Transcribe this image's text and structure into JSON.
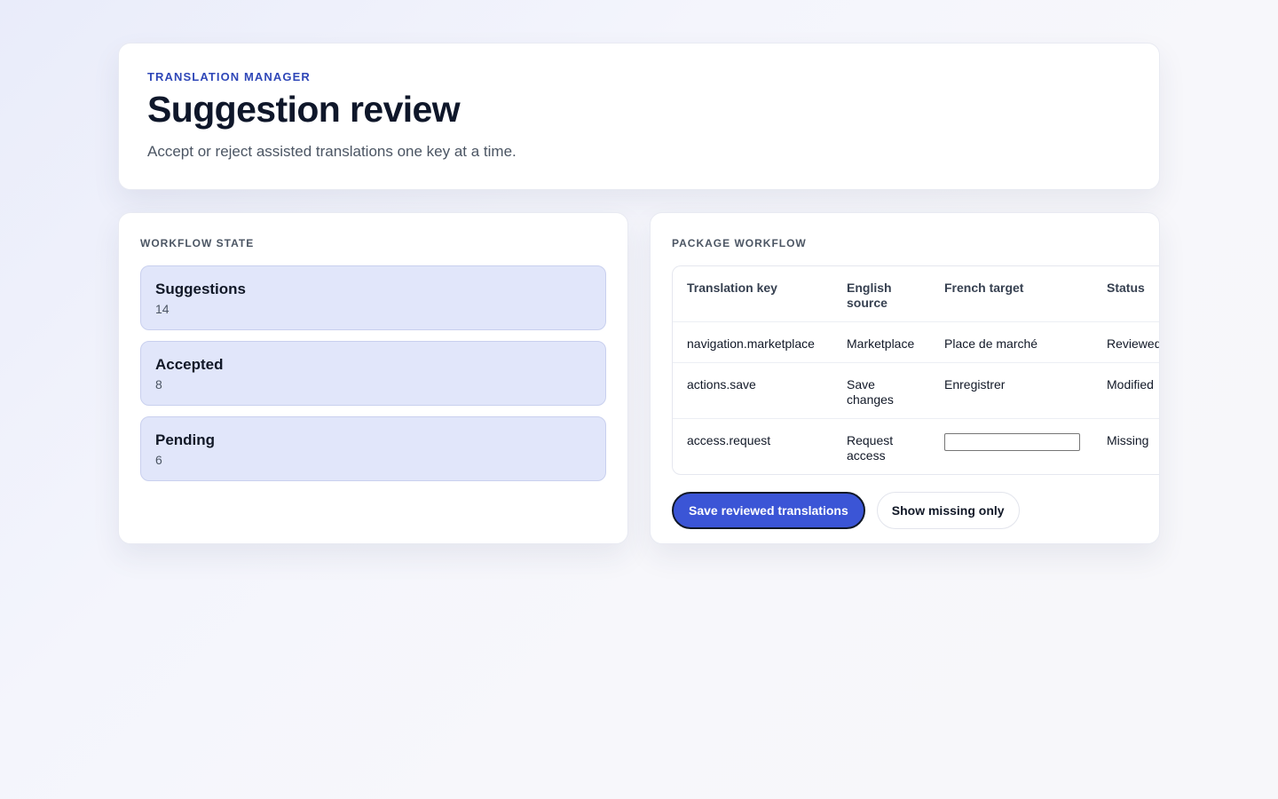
{
  "header": {
    "eyebrow": "TRANSLATION MANAGER",
    "title": "Suggestion review",
    "subtitle": "Accept or reject assisted translations one key at a time."
  },
  "workflow_state": {
    "label": "WORKFLOW STATE",
    "items": [
      {
        "name": "Suggestions",
        "count": "14"
      },
      {
        "name": "Accepted",
        "count": "8"
      },
      {
        "name": "Pending",
        "count": "6"
      }
    ]
  },
  "package_workflow": {
    "label": "PACKAGE WORKFLOW",
    "columns": [
      "Translation key",
      "English source",
      "French target",
      "Status"
    ],
    "rows": [
      {
        "key": "navigation.marketplace",
        "source": "Marketplace",
        "target": "Place de marché",
        "status": "Reviewed"
      },
      {
        "key": "actions.save",
        "source": "Save changes",
        "target": "Enregistrer",
        "status": "Modified"
      },
      {
        "key": "access.request",
        "source": "Request access",
        "target": "",
        "status": "Missing"
      }
    ],
    "save_button": "Save reviewed translations",
    "filter_button": "Show missing only"
  },
  "colors": {
    "accent": "#3b55d6",
    "eyebrow": "#2f47b8",
    "state_card_bg": "#e1e6fa"
  }
}
